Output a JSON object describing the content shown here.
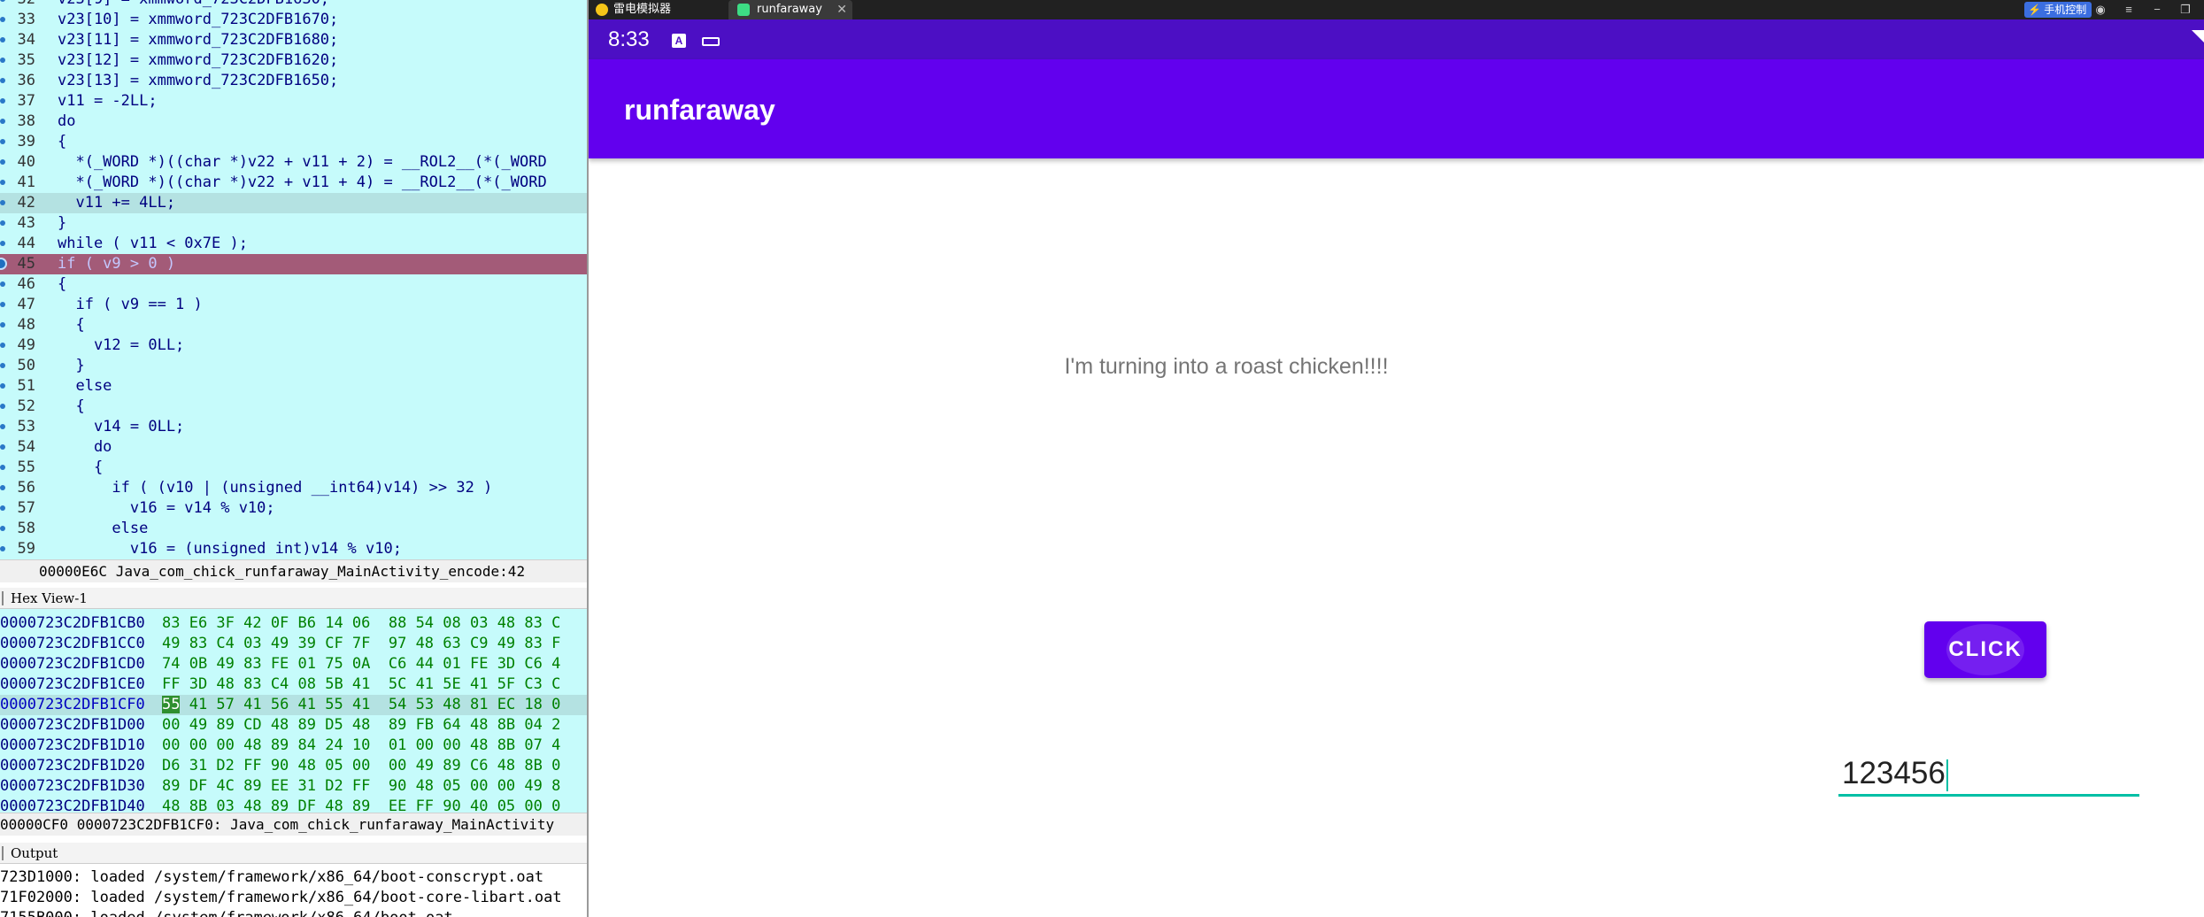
{
  "ida": {
    "code_lines": [
      {
        "n": "32",
        "t": "v23[9] = xmmword_723C2DFB1630;"
      },
      {
        "n": "33",
        "t": "v23[10] = xmmword_723C2DFB1670;"
      },
      {
        "n": "34",
        "t": "v23[11] = xmmword_723C2DFB1680;"
      },
      {
        "n": "35",
        "t": "v23[12] = xmmword_723C2DFB1620;"
      },
      {
        "n": "36",
        "t": "v23[13] = xmmword_723C2DFB1650;"
      },
      {
        "n": "37",
        "t": "v11 = -2LL;"
      },
      {
        "n": "38",
        "t": "do"
      },
      {
        "n": "39",
        "t": "{"
      },
      {
        "n": "40",
        "t": "  *(_WORD *)((char *)v22 + v11 + 2) = __ROL2__(*(_WORD"
      },
      {
        "n": "41",
        "t": "  *(_WORD *)((char *)v22 + v11 + 4) = __ROL2__(*(_WORD"
      },
      {
        "n": "42",
        "t": "  v11 += 4LL;"
      },
      {
        "n": "43",
        "t": "}"
      },
      {
        "n": "44",
        "t": "while ( v11 < 0x7E );"
      },
      {
        "n": "45",
        "t": "if ( v9 > 0 )"
      },
      {
        "n": "46",
        "t": "{"
      },
      {
        "n": "47",
        "t": "  if ( v9 == 1 )"
      },
      {
        "n": "48",
        "t": "  {"
      },
      {
        "n": "49",
        "t": "    v12 = 0LL;"
      },
      {
        "n": "50",
        "t": "  }"
      },
      {
        "n": "51",
        "t": "  else"
      },
      {
        "n": "52",
        "t": "  {"
      },
      {
        "n": "53",
        "t": "    v14 = 0LL;"
      },
      {
        "n": "54",
        "t": "    do"
      },
      {
        "n": "55",
        "t": "    {"
      },
      {
        "n": "56",
        "t": "      if ( (v10 | (unsigned __int64)v14) >> 32 )"
      },
      {
        "n": "57",
        "t": "        v16 = v14 % v10;"
      },
      {
        "n": "58",
        "t": "      else"
      },
      {
        "n": "59",
        "t": "        v16 = (unsigned int)v14 % v10;"
      }
    ],
    "status_pseudocode": "00000E6C Java_com_chick_runfaraway_MainActivity_encode:42",
    "hex_title": "Hex View-1",
    "hex_rows": [
      {
        "addr": "0000723C2DFB1CB0",
        "pre": "",
        "hl": "",
        "post": "83 E6 3F 42 0F B6 14 06  88 54 08 03 48 83 C"
      },
      {
        "addr": "0000723C2DFB1CC0",
        "pre": "",
        "hl": "",
        "post": "49 83 C4 03 49 39 CF 7F  97 48 63 C9 49 83 F"
      },
      {
        "addr": "0000723C2DFB1CD0",
        "pre": "",
        "hl": "",
        "post": "74 0B 49 83 FE 01 75 0A  C6 44 01 FE 3D C6 4"
      },
      {
        "addr": "0000723C2DFB1CE0",
        "pre": "",
        "hl": "",
        "post": "FF 3D 48 83 C4 08 5B 41  5C 41 5E 41 5F C3 C"
      },
      {
        "addr": "0000723C2DFB1CF0",
        "pre": "",
        "hl": "55",
        "post": " 41 57 41 56 41 55 41  54 53 48 81 EC 18 0"
      },
      {
        "addr": "0000723C2DFB1D00",
        "pre": "",
        "hl": "",
        "post": "00 49 89 CD 48 89 D5 48  89 FB 64 48 8B 04 2"
      },
      {
        "addr": "0000723C2DFB1D10",
        "pre": "",
        "hl": "",
        "post": "00 00 00 48 89 84 24 10  01 00 00 48 8B 07 4"
      },
      {
        "addr": "0000723C2DFB1D20",
        "pre": "",
        "hl": "",
        "post": "D6 31 D2 FF 90 48 05 00  00 49 89 C6 48 8B 0"
      },
      {
        "addr": "0000723C2DFB1D30",
        "pre": "",
        "hl": "",
        "post": "89 DF 4C 89 EE 31 D2 FF  90 48 05 00 00 49 8"
      },
      {
        "addr": "0000723C2DFB1D40",
        "pre": "",
        "hl": "",
        "post": "48 8B 03 48 89 DF 48 89  EE FF 90 40 05 00 0"
      }
    ],
    "status_hex": "00000CF0 0000723C2DFB1CF0: Java_com_chick_runfaraway_MainActivity",
    "output_title": "Output",
    "output_lines": [
      "723D1000: loaded /system/framework/x86_64/boot-conscrypt.oat",
      "71F02000: loaded /system/framework/x86_64/boot-core-libart.oat",
      "7155B000: loaded /system/framework/x86_64/boot.oat"
    ]
  },
  "emulator": {
    "tab1_label": "雷电模拟器",
    "tab2_label": "runfaraway",
    "tab_close": "✕",
    "control_label": "⚡ 手机控制",
    "window_icons": [
      "◉",
      "≡",
      "−",
      "❐"
    ],
    "time": "8:33",
    "a_icon": "A",
    "app_title": "runfaraway",
    "message": "I'm turning into a roast chicken!!!!",
    "button_label": "CLICK",
    "input_value": "123456"
  },
  "colors": {
    "status_bar": "#4c0fc4",
    "app_bar": "#6200ee",
    "accent": "#00bfa5",
    "code_bg": "#c6fbfb",
    "breakpoint_line": "#a35b78"
  }
}
